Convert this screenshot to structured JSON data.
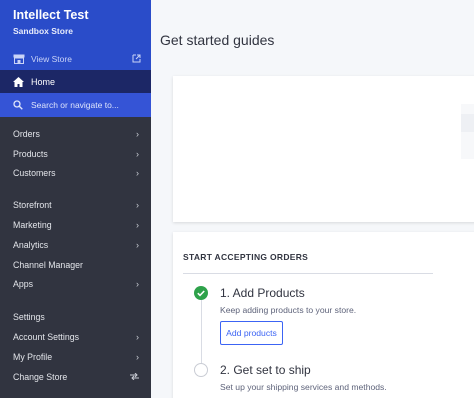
{
  "store": {
    "name": "Intellect Test",
    "subtitle": "Sandbox Store",
    "view_store_label": "View Store"
  },
  "nav": {
    "home_label": "Home",
    "search_placeholder": "Search or navigate to...",
    "group1": [
      {
        "label": "Orders",
        "chevron": true
      },
      {
        "label": "Products",
        "chevron": true
      },
      {
        "label": "Customers",
        "chevron": true
      }
    ],
    "group2": [
      {
        "label": "Storefront",
        "chevron": true
      },
      {
        "label": "Marketing",
        "chevron": true
      },
      {
        "label": "Analytics",
        "chevron": true
      },
      {
        "label": "Channel Manager",
        "chevron": false
      },
      {
        "label": "Apps",
        "chevron": true
      }
    ],
    "group3": [
      {
        "label": "Settings",
        "chevron": false
      },
      {
        "label": "Account Settings",
        "chevron": true
      },
      {
        "label": "My Profile",
        "chevron": true
      },
      {
        "label": "Change Store",
        "chevron": false,
        "icon": "swap-icon"
      }
    ]
  },
  "main": {
    "title": "Get started guides",
    "section_title": "START ACCEPTING ORDERS",
    "steps": [
      {
        "title": "1. Add Products",
        "desc": "Keep adding products to your store.",
        "button": "Add products",
        "status": "complete"
      },
      {
        "title": "2. Get set to ship",
        "desc": "Set up your shipping services and methods.",
        "status": "pending"
      }
    ]
  },
  "colors": {
    "sidebar_bg": "#313440",
    "brand_blue": "#3c64f4",
    "active_bg": "#1c2766",
    "success_green": "#2ea24a"
  }
}
